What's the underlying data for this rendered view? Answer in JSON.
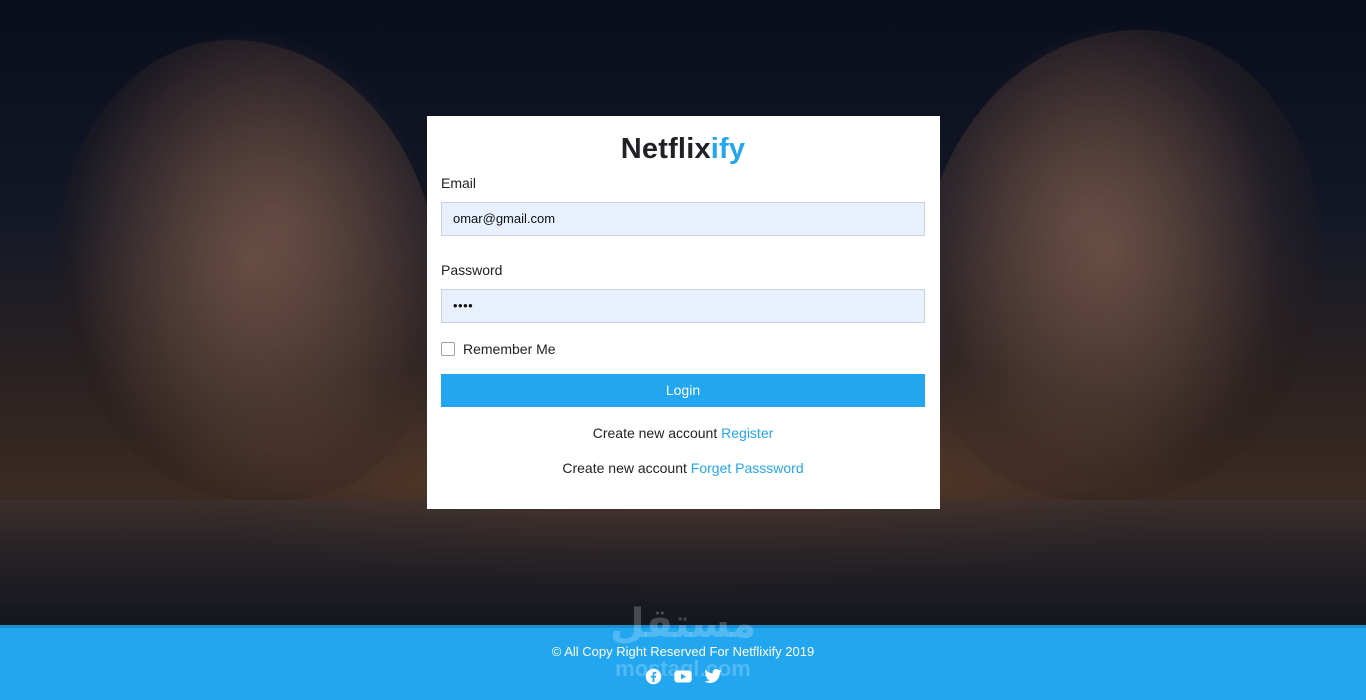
{
  "brand": {
    "name_main": "Netflix",
    "name_accent": "ify",
    "accent_color": "#22a6ef"
  },
  "form": {
    "email_label": "Email",
    "email_value": "omar@gmail.com",
    "password_label": "Password",
    "password_value": "••••",
    "remember_label": "Remember Me",
    "remember_checked": false,
    "login_label": "Login"
  },
  "links": {
    "register_prefix": "Create new account",
    "register_link": "Register",
    "forgot_prefix": "Create new account",
    "forgot_link": "Forget Passsword"
  },
  "footer": {
    "copyright": "© All Copy Right Reserved For Netflixify 2019",
    "social_icons": [
      "facebook-icon",
      "youtube-icon",
      "twitter-icon"
    ],
    "background_color": "#22a6ef"
  },
  "watermark": {
    "arabic": "مستقل",
    "latin": "mostaql.com"
  }
}
